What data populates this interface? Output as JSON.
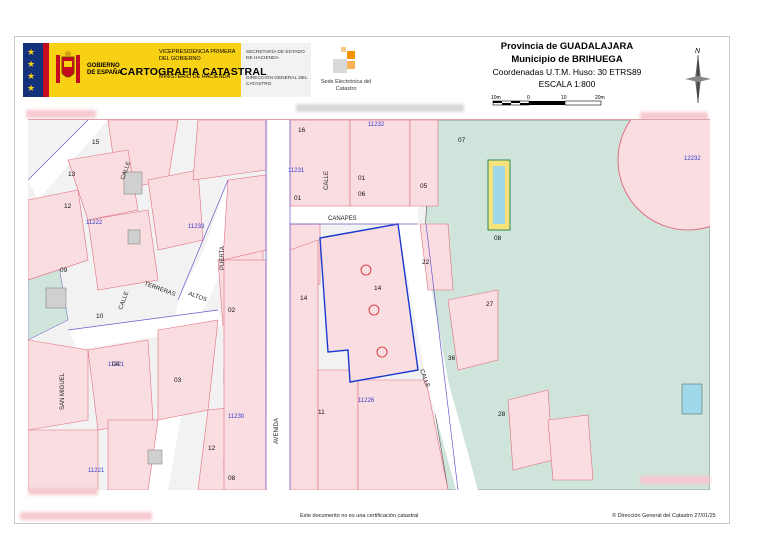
{
  "header": {
    "gobierno": "GOBIERNO DE ESPAÑA",
    "vicepresidencia": "VICEPRESIDENCIA PRIMERA DEL GOBIERNO",
    "ministerio": "MINISTERIO DE HACIENDA",
    "secretaria": "SECRETARÍA DE ESTADO DE HACIENDA",
    "direccion": "DIRECCIÓN GENERAL DEL CATASTRO",
    "sede": "Sede Electrónica del Catastro",
    "provincia": "Provincia de GUADALAJARA",
    "municipio": "Municipio de BRIHUEGA",
    "coordenadas": "Coordenadas U.T.M. Huso: 30 ETRS89",
    "escala": "ESCALA 1:800",
    "scale_ticks": [
      "10m",
      "0",
      "10",
      "20m"
    ],
    "carto_title": "CARTOGRAFIA CATASTRAL",
    "north_label": "N"
  },
  "colors": {
    "parcel_fill": "#f9dde0",
    "parcel_stroke": "#e07080",
    "green_area": "#cfe4da",
    "grey_building": "#d0d0d0",
    "block_stroke": "#6a5acd",
    "selected_stroke": "#1a3ad0",
    "label_red": "#d0202a",
    "label_blue": "#3a3ad0",
    "gov_yellow": "#f8d115"
  },
  "map": {
    "street_names": [
      "CALLE",
      "CALLE",
      "CALLE",
      "CALLE",
      "CANAPES",
      "AVENIDA",
      "PUERTA",
      "ALTOS",
      "TERRERAS",
      "SAN MIGUEL"
    ],
    "block_numbers": [
      "11222",
      "11221",
      "11230",
      "11232",
      "11231",
      "11233",
      "11226",
      "11221",
      "12232"
    ],
    "parcel_numbers": [
      "15",
      "16",
      "13",
      "12",
      "14",
      "09",
      "10",
      "11",
      "01",
      "02",
      "03",
      "04",
      "05",
      "06",
      "07",
      "08",
      "12",
      "22",
      "27",
      "28",
      "36",
      "01",
      "08",
      "14"
    ]
  },
  "footer": {
    "note": "Este documento no es una certificación catastral",
    "copyright": "© Dirección General del Catastro 27/01/25"
  }
}
